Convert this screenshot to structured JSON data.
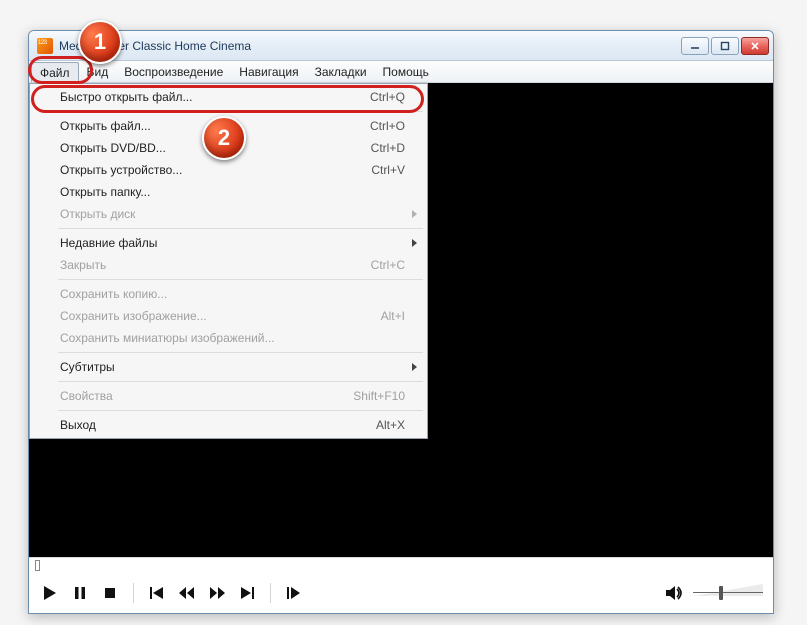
{
  "window": {
    "title": "Media Player Classic Home Cinema"
  },
  "menubar": {
    "items": [
      {
        "label": "Файл",
        "active": true
      },
      {
        "label": "Вид"
      },
      {
        "label": "Воспроизведение"
      },
      {
        "label": "Навигация"
      },
      {
        "label": "Закладки"
      },
      {
        "label": "Помощь"
      }
    ]
  },
  "dropdown": [
    {
      "type": "item",
      "label": "Быстро открыть файл...",
      "shortcut": "Ctrl+Q"
    },
    {
      "type": "sep"
    },
    {
      "type": "item",
      "label": "Открыть файл...",
      "shortcut": "Ctrl+O"
    },
    {
      "type": "item",
      "label": "Открыть DVD/BD...",
      "shortcut": "Ctrl+D"
    },
    {
      "type": "item",
      "label": "Открыть устройство...",
      "shortcut": "Ctrl+V"
    },
    {
      "type": "item",
      "label": "Открыть папку..."
    },
    {
      "type": "item",
      "label": "Открыть диск",
      "submenu": true,
      "disabled": true
    },
    {
      "type": "sep"
    },
    {
      "type": "item",
      "label": "Недавние файлы",
      "submenu": true
    },
    {
      "type": "item",
      "label": "Закрыть",
      "shortcut": "Ctrl+C",
      "disabled": true
    },
    {
      "type": "sep"
    },
    {
      "type": "item",
      "label": "Сохранить копию...",
      "disabled": true
    },
    {
      "type": "item",
      "label": "Сохранить изображение...",
      "shortcut": "Alt+I",
      "disabled": true
    },
    {
      "type": "item",
      "label": "Сохранить миниатюры изображений...",
      "disabled": true
    },
    {
      "type": "sep"
    },
    {
      "type": "item",
      "label": "Субтитры",
      "submenu": true
    },
    {
      "type": "sep"
    },
    {
      "type": "item",
      "label": "Свойства",
      "shortcut": "Shift+F10",
      "disabled": true
    },
    {
      "type": "sep"
    },
    {
      "type": "item",
      "label": "Выход",
      "shortcut": "Alt+X"
    }
  ],
  "annotations": {
    "badge1": "1",
    "badge2": "2"
  }
}
